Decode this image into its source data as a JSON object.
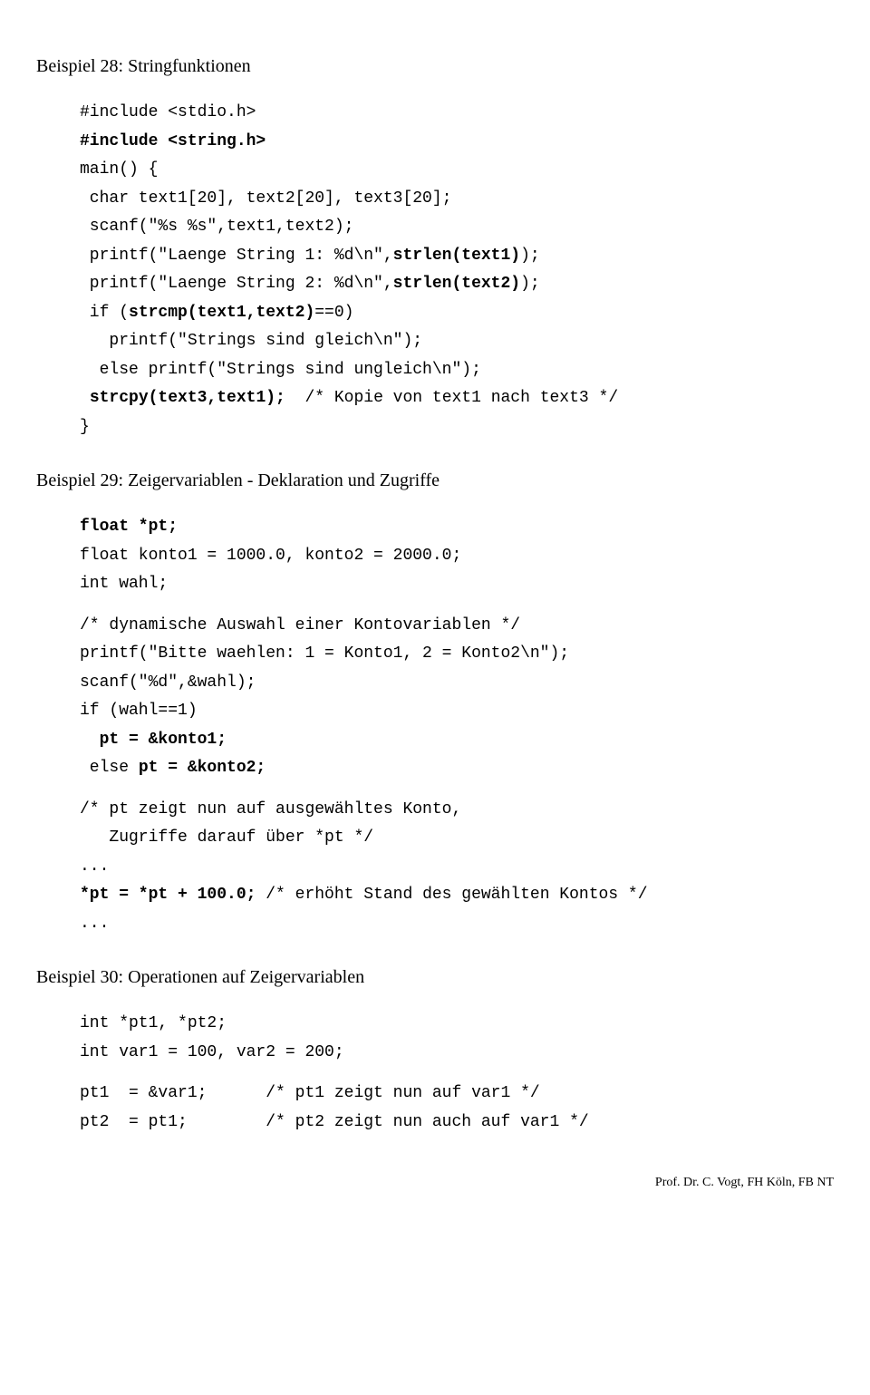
{
  "sec28": {
    "title": "Beispiel 28:  Stringfunktionen",
    "lines": [
      {
        "t": "#include <stdio.h>"
      },
      {
        "t": "#include <string.h>",
        "b": true
      },
      {
        "t": "main() {"
      },
      {
        "t": " char text1[20], text2[20], text3[20];"
      },
      {
        "t": " scanf(\"%s %s\",text1,text2);"
      },
      {
        "pre": " printf(\"Laenge String 1: %d\\n\",",
        "bold": "strlen(text1)",
        "post": ");"
      },
      {
        "pre": " printf(\"Laenge String 2: %d\\n\",",
        "bold": "strlen(text2)",
        "post": ");"
      },
      {
        "pre": " if (",
        "bold": "strcmp(text1,text2)",
        "post": "==0)"
      },
      {
        "t": "   printf(\"Strings sind gleich\\n\");"
      },
      {
        "t": "  else printf(\"Strings sind ungleich\\n\");"
      },
      {
        "pre": " ",
        "bold": "strcpy(text3,text1);",
        "post": "  /* Kopie von text1 nach text3 */"
      },
      {
        "t": "}"
      }
    ]
  },
  "sec29": {
    "title": "Beispiel 29:  Zeigervariablen - Deklaration und Zugriffe",
    "block1": [
      {
        "t": "float *pt;",
        "b": true
      },
      {
        "t": "float konto1 = 1000.0, konto2 = 2000.0;"
      },
      {
        "t": "int wahl;"
      }
    ],
    "block2": [
      {
        "t": "/* dynamische Auswahl einer Kontovariablen */"
      },
      {
        "t": "printf(\"Bitte waehlen: 1 = Konto1, 2 = Konto2\\n\");"
      },
      {
        "t": "scanf(\"%d\",&wahl);"
      },
      {
        "t": "if (wahl==1)"
      },
      {
        "pre": "  ",
        "bold": "pt = &konto1;",
        "post": ""
      },
      {
        "pre": " else ",
        "bold": "pt = &konto2;",
        "post": ""
      }
    ],
    "block3": [
      {
        "t": "/* pt zeigt nun auf ausgewähltes Konto,"
      },
      {
        "t": "   Zugriffe darauf über *pt */"
      },
      {
        "t": "..."
      },
      {
        "bold": "*pt = *pt + 100.0;",
        "post": " /* erhöht Stand des gewählten Kontos */"
      },
      {
        "t": "..."
      }
    ]
  },
  "sec30": {
    "title": "Beispiel 30:  Operationen auf Zeigervariablen",
    "block1": [
      {
        "t": "int *pt1, *pt2;"
      },
      {
        "t": "int var1 = 100, var2 = 200;"
      }
    ],
    "block2": [
      {
        "t": "pt1  = &var1;      /* pt1 zeigt nun auf var1 */"
      },
      {
        "t": "pt2  = pt1;        /* pt2 zeigt nun auch auf var1 */"
      }
    ]
  },
  "footer": "Prof. Dr. C. Vogt, FH Köln, FB NT"
}
